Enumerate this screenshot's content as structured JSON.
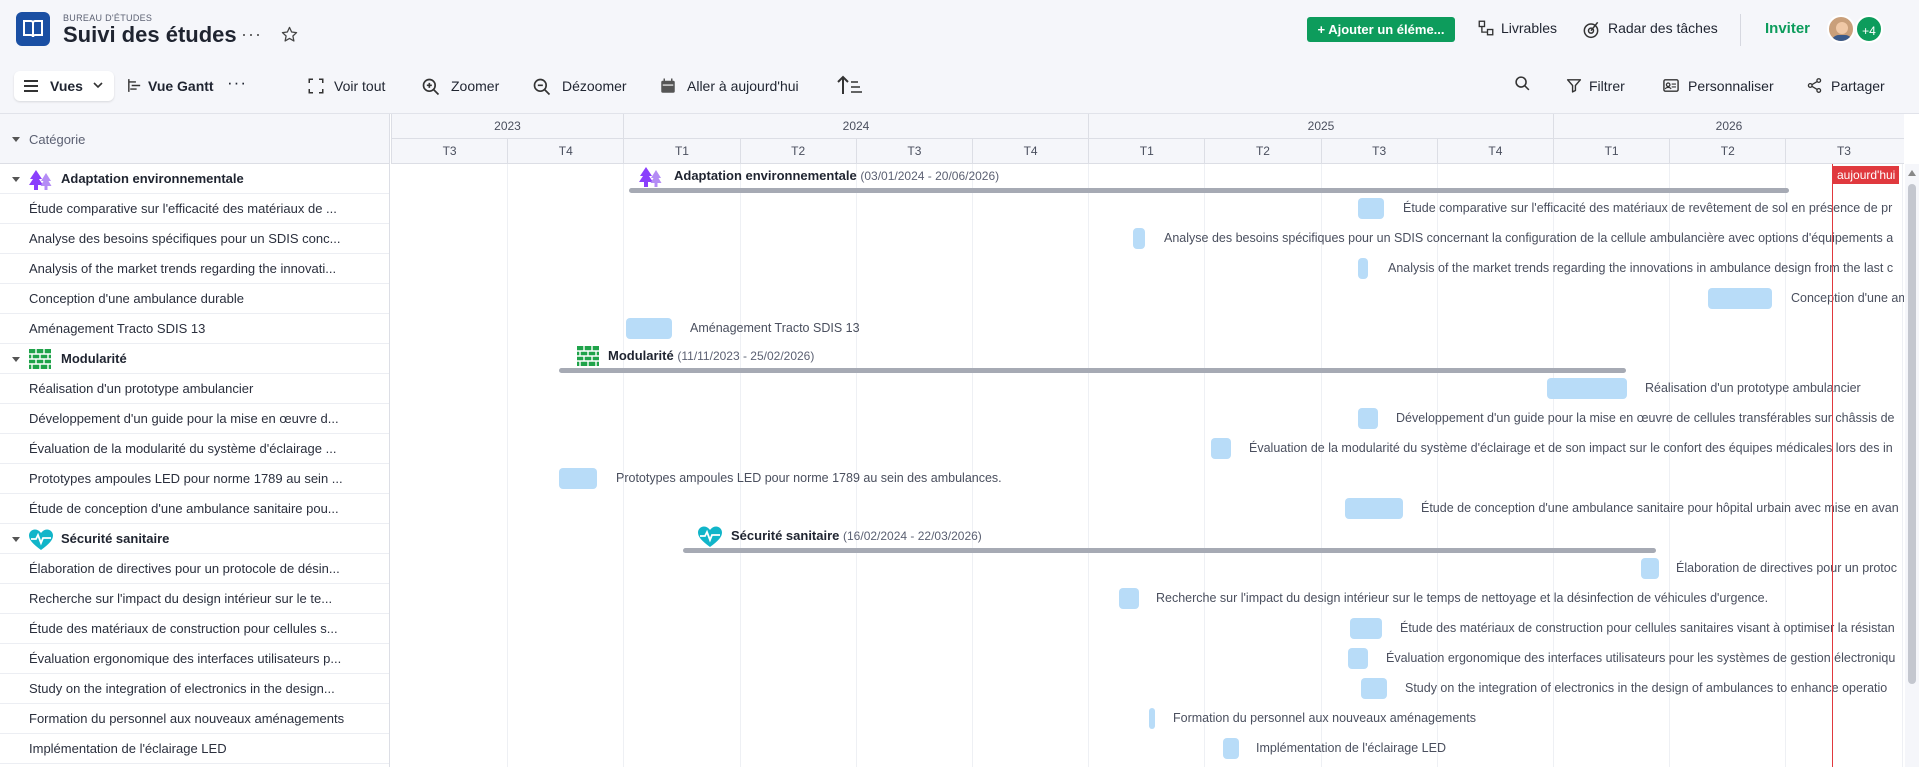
{
  "header": {
    "workspace": "BUREAU D'ÉTUDES",
    "title": "Suivi des études",
    "more": "···",
    "add_button": "+ Ajouter un éléme...",
    "deliverables": "Livrables",
    "task_radar": "Radar des tâches",
    "invite": "Inviter",
    "extra_members": "+4"
  },
  "toolbar": {
    "views": "Vues",
    "gantt": "Vue Gantt",
    "more": "···",
    "see_all": "Voir tout",
    "zoom_in": "Zoomer",
    "zoom_out": "Dézoomer",
    "go_today": "Aller à aujourd'hui",
    "filter": "Filtrer",
    "customize": "Personnaliser",
    "share": "Partager"
  },
  "grid": {
    "column_header": "Catégorie",
    "today": "aujourd'hui",
    "years": [
      "2023",
      "2024",
      "2025",
      "2026"
    ],
    "quarters": [
      "T3",
      "T4",
      "T1",
      "T2",
      "T3",
      "T4",
      "T1",
      "T2",
      "T3",
      "T4",
      "T1",
      "T2",
      "T3"
    ]
  },
  "groups": [
    {
      "name": "Adaptation environnementale",
      "range": "(03/01/2024 - 20/06/2026)",
      "icon": "trees-icon",
      "color": "#8a3ffc",
      "tasks": [
        {
          "left": "Étude comparative sur l'efficacité des matériaux de ...",
          "full": "Étude comparative sur l'efficacité des matériaux de revêtement de sol en présence de pr"
        },
        {
          "left": "Analyse des besoins spécifiques pour un SDIS conc...",
          "full": "Analyse des besoins spécifiques pour un SDIS concernant la configuration de la cellule ambulancière avec options d'équipements a"
        },
        {
          "left": "Analysis of the market trends regarding the innovati...",
          "full": "Analysis of the market trends regarding the innovations in ambulance design from the last c"
        },
        {
          "left": "Conception d'une ambulance durable",
          "full": "Conception d'une am"
        },
        {
          "left": "Aménagement Tracto SDIS 13",
          "full": "Aménagement Tracto SDIS 13"
        }
      ]
    },
    {
      "name": "Modularité",
      "range": "(11/11/2023 - 25/02/2026)",
      "icon": "brick-wall-icon",
      "color": "#1fa34a",
      "tasks": [
        {
          "left": "Réalisation d'un prototype ambulancier",
          "full": "Réalisation d'un prototype ambulancier"
        },
        {
          "left": "Développement d'un guide pour la mise en œuvre d...",
          "full": "Développement d'un guide pour la mise en œuvre de cellules transférables sur châssis de"
        },
        {
          "left": "Évaluation de la modularité du système d'éclairage ...",
          "full": "Évaluation de la modularité du système d'éclairage et de son impact sur le confort des équipes médicales lors des in"
        },
        {
          "left": "Prototypes ampoules LED pour norme 1789 au sein ...",
          "full": "Prototypes ampoules LED pour norme 1789 au sein des ambulances."
        },
        {
          "left": "Étude de conception d'une ambulance sanitaire pou...",
          "full": "Étude de conception d'une ambulance sanitaire pour hôpital urbain avec mise en avan"
        }
      ]
    },
    {
      "name": "Sécurité sanitaire",
      "range": "(16/02/2024 - 22/03/2026)",
      "icon": "heartbeat-icon",
      "color": "#11b5c9",
      "tasks": [
        {
          "left": "Élaboration de directives pour un protocole de désin...",
          "full": "Élaboration de directives pour un protoc"
        },
        {
          "left": "Recherche sur l'impact du design intérieur sur le te...",
          "full": "Recherche sur l'impact du design intérieur sur le temps de nettoyage et la désinfection de véhicules d'urgence."
        },
        {
          "left": "Étude des matériaux de construction pour cellules s...",
          "full": "Étude des matériaux de construction pour cellules sanitaires visant à optimiser la résistan"
        },
        {
          "left": "Évaluation ergonomique des interfaces utilisateurs p...",
          "full": "Évaluation ergonomique des interfaces utilisateurs pour les systèmes de gestion électroniqu"
        },
        {
          "left": "Study on the integration of electronics in the design...",
          "full": "Study on the integration of electronics in the design of ambulances to enhance operatio"
        },
        {
          "left": "Formation du personnel aux nouveaux aménagements",
          "full": "Formation du personnel aux nouveaux aménagements"
        },
        {
          "left": "Implémentation de l'éclairage LED",
          "full": "Implémentation de l'éclairage LED"
        }
      ]
    }
  ]
}
